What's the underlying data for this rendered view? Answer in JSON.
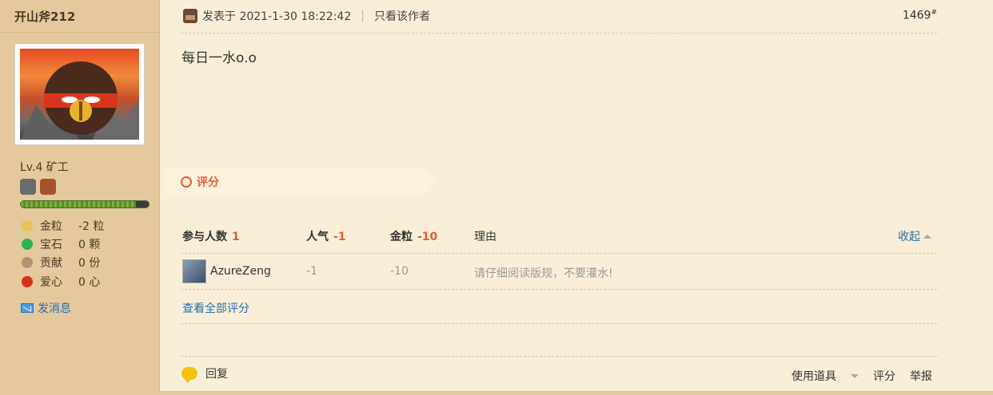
{
  "author": {
    "name": "开山斧212",
    "level": "Lv.4 矿工",
    "exp_fraction": 0.9,
    "stats": [
      {
        "icon": "gold-nugget-icon",
        "label": "金粒",
        "value": "-2 粒",
        "color": "#e8c25a"
      },
      {
        "icon": "emerald-icon",
        "label": "宝石",
        "value": "0 颗",
        "color": "#2fb24a"
      },
      {
        "icon": "contribution-icon",
        "label": "贡献",
        "value": "0 份",
        "color": "#b49374"
      },
      {
        "icon": "heart-apple-icon",
        "label": "爱心",
        "value": "0 心",
        "color": "#d9301c"
      }
    ],
    "send_message": "发消息"
  },
  "post": {
    "posted_label": "发表于 2021-1-30 18:22:42",
    "sep": "|",
    "only_author": "只看该作者",
    "floor": "1469",
    "floor_mark": "#",
    "content": "每日一水o.o"
  },
  "rating": {
    "title": "评分",
    "participants_label": "参与人数",
    "participants_count": "1",
    "popularity_label": "人气",
    "popularity_total": "-1",
    "gold_label": "金粒",
    "gold_total": "-10",
    "reason_label": "理由",
    "collapse": "收起",
    "rows": [
      {
        "user": "AzureZeng",
        "popularity": "-1",
        "gold": "-10",
        "reason": "请仔细阅读版规，不要灌水!"
      }
    ],
    "view_all": "查看全部评分"
  },
  "footer": {
    "reply": "回复",
    "use_item": "使用道具",
    "rate": "评分",
    "report": "举报"
  },
  "colors": {
    "sidebar_bg": "#e3c99b",
    "main_bg": "#f9efd8",
    "accent": "#e35b37",
    "link": "#2a6eb0"
  }
}
